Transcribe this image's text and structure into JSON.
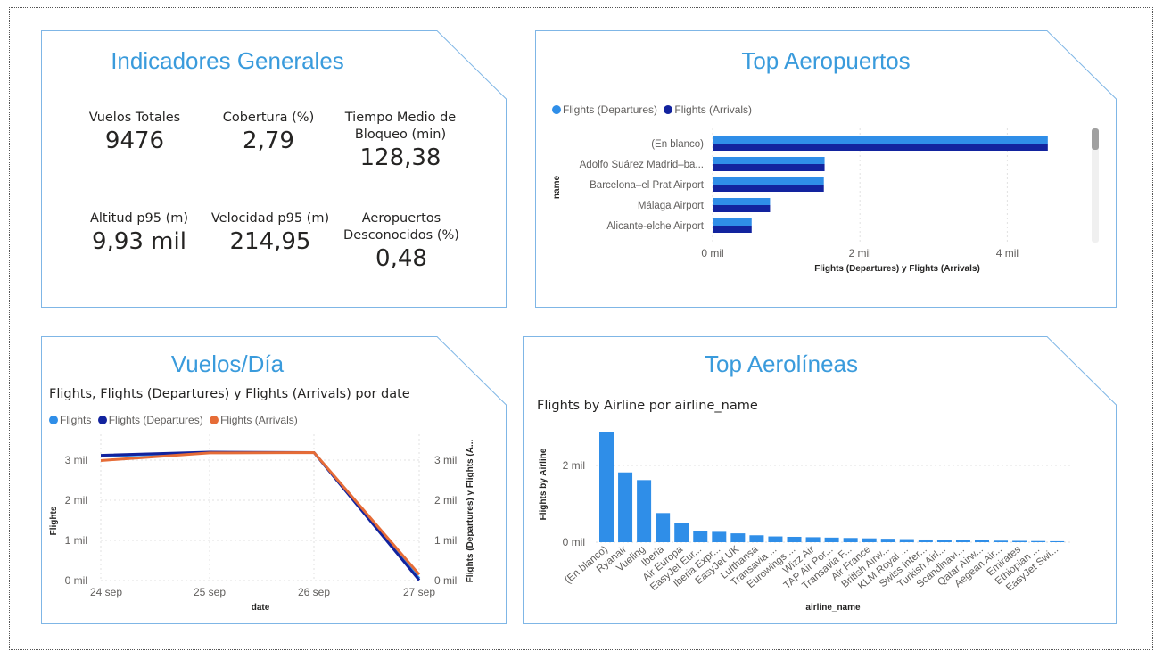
{
  "colors": {
    "accent_title": "#3a9bdc",
    "flights": "#2f8ee8",
    "departures": "#12239e",
    "arrivals": "#e66c37",
    "card_border": "#7fb6e6"
  },
  "kpi_card": {
    "title": "Indicadores Generales",
    "kpis": [
      {
        "label": "Vuelos Totales",
        "value": "9476"
      },
      {
        "label": "Cobertura (%)",
        "value": "2,79"
      },
      {
        "label": "Tiempo Medio de Bloqueo (min)",
        "value": "128,38"
      },
      {
        "label": "Altitud p95 (m)",
        "value": "9,93 mil"
      },
      {
        "label": "Velocidad p95 (m)",
        "value": "214,95"
      },
      {
        "label": "Aeropuertos Desconocidos (%)",
        "value": "0,48"
      }
    ]
  },
  "airports_card": {
    "title": "Top Aeropuertos",
    "legend": [
      "Flights (Departures)",
      "Flights (Arrivals)"
    ]
  },
  "daily_card": {
    "title": "Vuelos/Día",
    "subtitle": "Flights, Flights (Departures) y Flights (Arrivals) por date",
    "legend": [
      "Flights",
      "Flights (Departures)",
      "Flights (Arrivals)"
    ]
  },
  "airlines_card": {
    "title": "Top Aerolíneas",
    "subtitle": "Flights by Airline por airline_name"
  },
  "chart_data": [
    {
      "type": "bar",
      "orientation": "horizontal",
      "categories": [
        "(En blanco)",
        "Adolfo Suárez Madrid–ba...",
        "Barcelona–el Prat Airport",
        "Málaga Airport",
        "Alicante-elche Airport"
      ],
      "series": [
        {
          "name": "Flights (Departures)",
          "values": [
            4550,
            1520,
            1510,
            780,
            530
          ]
        },
        {
          "name": "Flights (Arrivals)",
          "values": [
            4550,
            1520,
            1510,
            780,
            530
          ]
        }
      ],
      "xlabel": "Flights (Departures) y Flights (Arrivals)",
      "ylabel": "name",
      "xlim": [
        0,
        5000
      ],
      "xticks": [
        "0 mil",
        "2 mil",
        "4 mil"
      ],
      "xtick_values": [
        0,
        2000,
        4000
      ],
      "grid": true,
      "legend": "top-left"
    },
    {
      "type": "line",
      "title": "Flights, Flights (Departures) y Flights (Arrivals) por date",
      "x": [
        "24 sep",
        "25 sep",
        "26 sep",
        "27 sep"
      ],
      "series": [
        {
          "name": "Flights",
          "values": [
            3100,
            3190,
            3190,
            50
          ]
        },
        {
          "name": "Flights (Departures)",
          "values": [
            3120,
            3200,
            3190,
            10
          ]
        },
        {
          "name": "Flights (Arrivals)",
          "values": [
            2990,
            3180,
            3190,
            150
          ]
        }
      ],
      "xlabel": "date",
      "ylabel": "Flights",
      "y2label": "Flights (Departures) y Flights (A...",
      "ylim": [
        0,
        3300
      ],
      "yticks": [
        "0 mil",
        "1 mil",
        "2 mil",
        "3 mil"
      ],
      "ytick_values": [
        0,
        1000,
        2000,
        3000
      ],
      "grid": true,
      "legend": "top-left"
    },
    {
      "type": "bar",
      "title": "Flights by Airline por airline_name",
      "categories": [
        "(En blanco)",
        "Ryanair",
        "Vueling",
        "Iberia",
        "Air Europa",
        "EasyJet Eur...",
        "Iberia Expr...",
        "EasyJet UK",
        "Lufthansa",
        "Transavia ...",
        "Eurowings ...",
        "Wizz Air",
        "TAP Air Por...",
        "Transavia F...",
        "Air France",
        "British Airw...",
        "KLM Royal ...",
        "Swiss Inter...",
        "Turkish Airl...",
        "Scandinavi...",
        "Qatar Airw...",
        "Aegean Air...",
        "Emirates",
        "Ethiopian ...",
        "EasyJet Swi..."
      ],
      "values": [
        2870,
        1820,
        1620,
        760,
        510,
        300,
        270,
        230,
        180,
        150,
        140,
        130,
        120,
        110,
        100,
        90,
        80,
        70,
        65,
        60,
        50,
        40,
        35,
        30,
        25
      ],
      "xlabel": "airline_name",
      "ylabel": "Flights by Airline",
      "ylim": [
        0,
        3000
      ],
      "yticks": [
        "0 mil",
        "2 mil"
      ],
      "ytick_values": [
        0,
        2000
      ],
      "grid": true
    }
  ]
}
